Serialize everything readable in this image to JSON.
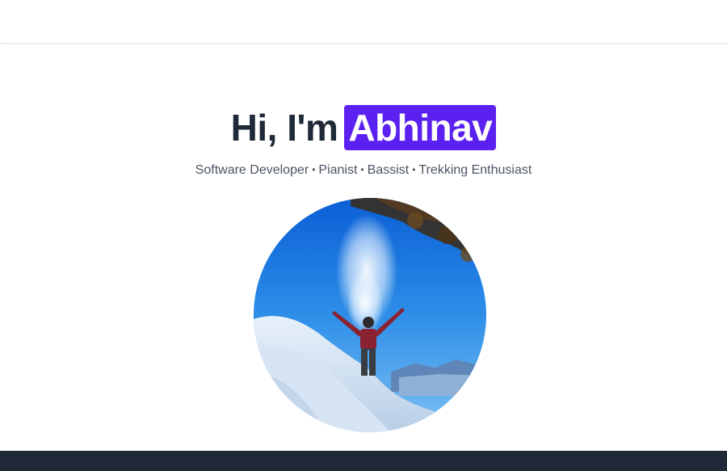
{
  "hero": {
    "greeting": "Hi, I'm",
    "name": "Abhinav",
    "roles": [
      "Software Developer",
      "Pianist",
      "Bassist",
      "Trekking Enthusiast"
    ],
    "separator": "•",
    "accent_color": "#5b21f0"
  },
  "colors": {
    "heading": "#1f2937",
    "subtext": "#4b5563",
    "footer_bg": "#1f2937"
  }
}
